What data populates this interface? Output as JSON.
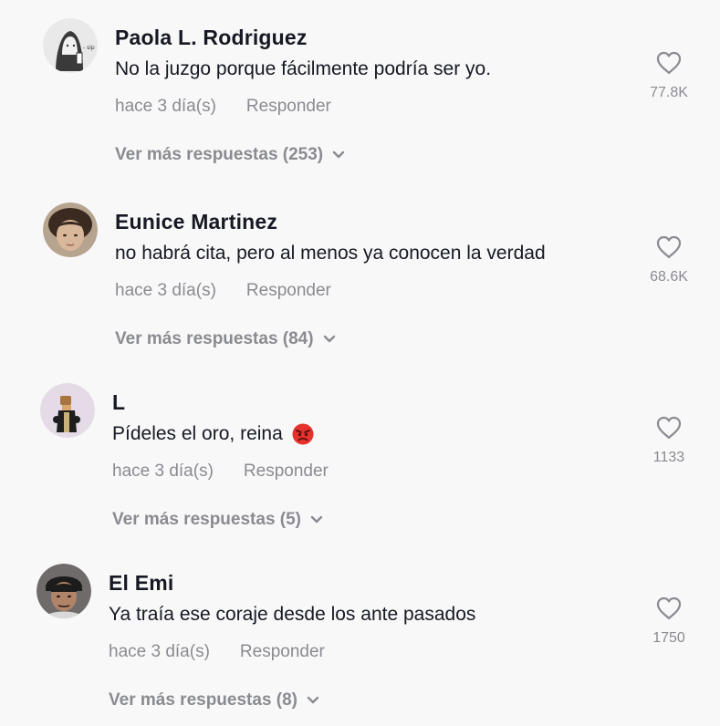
{
  "comments": [
    {
      "username": "Paola L. Rodriguez",
      "text": "No la juzgo porque fácilmente podría ser yo.",
      "time": "hace 3 día(s)",
      "reply_label": "Responder",
      "more_replies": "Ver más respuestas (253)",
      "likes": "77.8K",
      "avatar": "sketch-girl-avatar"
    },
    {
      "username": "Eunice Martinez",
      "text": "no habrá cita, pero al menos ya conocen la verdad",
      "time": "hace 3 día(s)",
      "reply_label": "Responder",
      "more_replies": "Ver más respuestas (84)",
      "likes": "68.6K",
      "avatar": "photo-avatar"
    },
    {
      "username": "L",
      "text": "Pídeles el oro, reina",
      "emoji": "angry-face-emoji",
      "time": "hace 3 día(s)",
      "reply_label": "Responder",
      "more_replies": "Ver más respuestas (5)",
      "likes": "1133",
      "avatar": "figure-avatar"
    },
    {
      "username": "El Emi",
      "text": "Ya traía ese coraje desde los ante pasados",
      "time": "hace 3 día(s)",
      "reply_label": "Responder",
      "more_replies": "Ver más respuestas (8)",
      "likes": "1750",
      "avatar": "photo-avatar"
    }
  ],
  "colors": {
    "background": "#f8f8f8",
    "text": "#161823",
    "secondary": "#8a8b91"
  }
}
